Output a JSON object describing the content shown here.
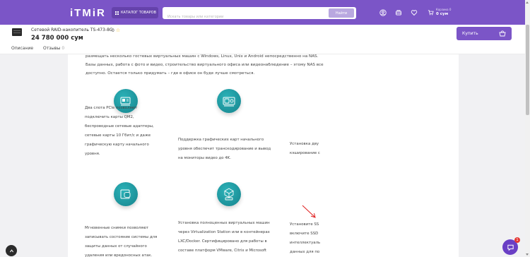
{
  "header": {
    "logo": "iTMiR",
    "catalog_label": "КАТАЛОГ ТОВАРОВ",
    "search_placeholder": "Искать товары или категории",
    "search_button": "Найти",
    "cart_label": "Корзина 0",
    "cart_total": "0 сум"
  },
  "product": {
    "name": "Сетевой RAID-накопитель TS-473-8G",
    "rating": "0",
    "price": "24 780 000 сум",
    "buy_label": "Купить"
  },
  "tabs": [
    {
      "label": "Описание",
      "count": ""
    },
    {
      "label": "Отзывы",
      "count": "0"
    }
  ],
  "intro_lines": [
    "размещать несколько гостевых виртуальных машин с Windows, Linux, Unix и Android непосредственно на NAS.",
    "Базы данных, работа с фото и видео, строительство виртуального офиса или видеонаблюдение – этому NAS все",
    "доступно. Остается только придумать – где в офисе он буде лучше смотреться."
  ],
  "features": [
    {
      "icon": "pcie-card-icon",
      "lines": [
        "Два слота PCIe позволяют",
        "подключить карты QM2,",
        "беспроводные сетевые адаптеры,",
        "сетевые карты 10 Гбит/с и даже",
        "графическую карту начального",
        "уровня."
      ]
    },
    {
      "icon": "graphics-card-icon",
      "lines": [
        "Поддержка графических карт начального",
        "уровня обеспечит транскодирование и вывод",
        "на мониторы видео до 4K."
      ]
    },
    {
      "icon": "",
      "lines": [
        "Установка дву",
        "кэширование с"
      ]
    },
    {
      "icon": "snapshot-database-icon",
      "lines": [
        "Мгновенные снимки позволяют",
        "записывать состояние системы для",
        "защиты данных от случайного",
        "удаления или вредоносных атак."
      ]
    },
    {
      "icon": "virtualization-cube-icon",
      "lines": [
        "Установка полноценных  виртуальных машин",
        "через Virtualization Station или в контейнерах",
        "LXC/Docker.  Сертифицировано для работы в",
        "составе платформ VMware, Citrix и Microsoft"
      ]
    },
    {
      "icon": "",
      "lines": [
        "Установите SS",
        "включите SSD",
        "интеллектуаль",
        "данных для по"
      ]
    }
  ],
  "chat_badge": "1",
  "colors": {
    "brand": "#7b55c7",
    "teal": "#1e9aa2",
    "page_bg": "#f1f1f3"
  }
}
